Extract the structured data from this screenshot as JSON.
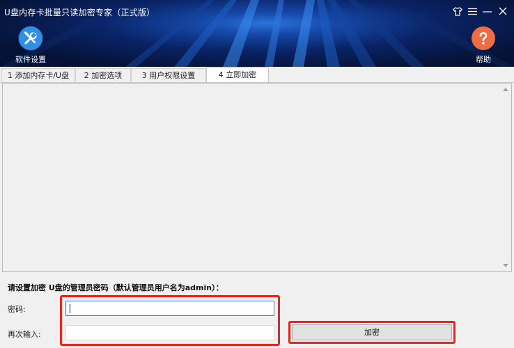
{
  "window": {
    "title": "U盘内存卡批量只读加密专家（正式版）"
  },
  "toolbar": {
    "settings_label": "软件设置",
    "help_label": "帮助"
  },
  "tabs": [
    {
      "label": "1 添加内存卡/U盘"
    },
    {
      "label": "2 加密选项"
    },
    {
      "label": "3 用户权限设置"
    },
    {
      "label": "4 立即加密"
    }
  ],
  "form": {
    "prompt": "请设置加密 U盘的管理员密码（默认管理员用户名为admin）：",
    "password_label": "密码:",
    "password_value": "",
    "confirm_label": "再次输入:",
    "confirm_value": "",
    "encrypt_button": "加密"
  },
  "colors": {
    "highlight": "#e8231b",
    "settings_icon_bg": "#2f8fe6",
    "help_icon_bg": "#ee6c43",
    "focus_border": "#3d7bd6"
  },
  "icons": {
    "settings": "tools-icon",
    "help": "question-icon",
    "skin": "shirt-icon",
    "menu": "menu-icon",
    "minimize": "minimize-icon",
    "close": "close-icon"
  }
}
